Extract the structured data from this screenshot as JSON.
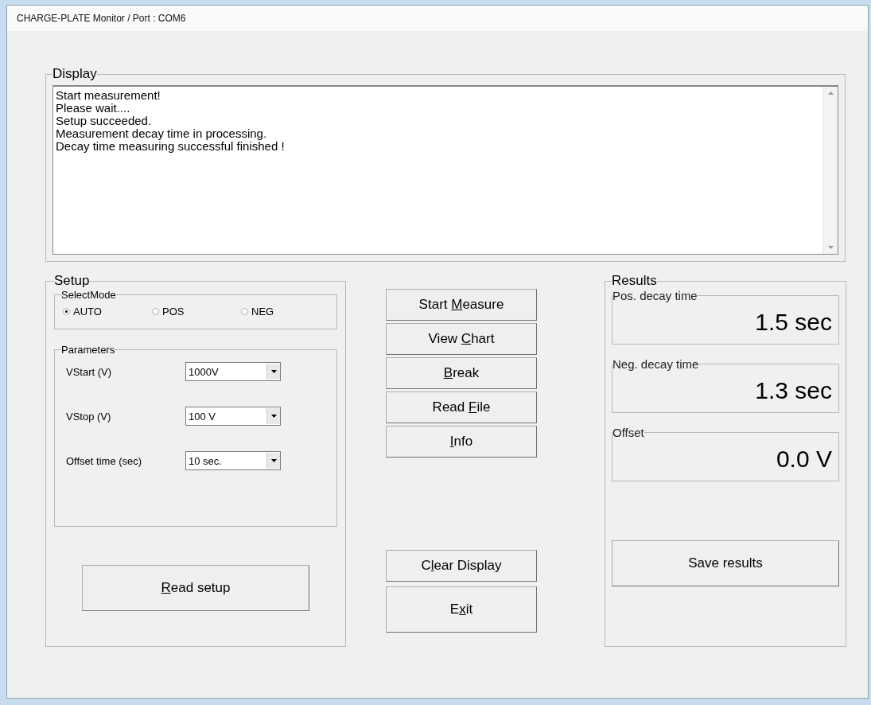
{
  "window": {
    "title": "CHARGE-PLATE Monitor / Port : COM6"
  },
  "display": {
    "title": "Display",
    "lines": [
      "Start measurement!",
      "Please wait....",
      "Setup succeeded.",
      "Measurement decay time in processing.",
      "Decay time measuring successful finished !"
    ]
  },
  "setup": {
    "title": "Setup",
    "select_mode": {
      "title": "SelectMode",
      "options": [
        {
          "label": "AUTO",
          "selected": true
        },
        {
          "label": "POS",
          "selected": false
        },
        {
          "label": "NEG",
          "selected": false
        }
      ]
    },
    "parameters": {
      "title": "Parameters",
      "fields": [
        {
          "label": "VStart (V)",
          "value": "1000V"
        },
        {
          "label": "VStop (V)",
          "value": "100 V"
        },
        {
          "label": "Offset time (sec)",
          "value": "10 sec."
        }
      ]
    },
    "button": {
      "key": "R",
      "after": "ead setup"
    }
  },
  "actions": {
    "top": [
      {
        "before": "Start ",
        "key": "M",
        "after": "easure"
      },
      {
        "before": "View ",
        "key": "C",
        "after": "hart"
      },
      {
        "key": "B",
        "after": "reak"
      },
      {
        "before": "Read ",
        "key": "F",
        "after": "ile"
      },
      {
        "key": "I",
        "after": "nfo"
      }
    ],
    "bottom": [
      {
        "before": "C",
        "key": "l",
        "after": "ear Display"
      },
      {
        "before": "E",
        "key": "x",
        "after": "it"
      }
    ]
  },
  "results": {
    "title": "Results",
    "items": [
      {
        "label": "Pos. decay time",
        "value": "1.5 sec"
      },
      {
        "label": "Neg. decay time",
        "value": "1.3 sec"
      },
      {
        "label": "Offset",
        "value": "0.0 V"
      }
    ],
    "button": {
      "before": "Save results"
    }
  }
}
